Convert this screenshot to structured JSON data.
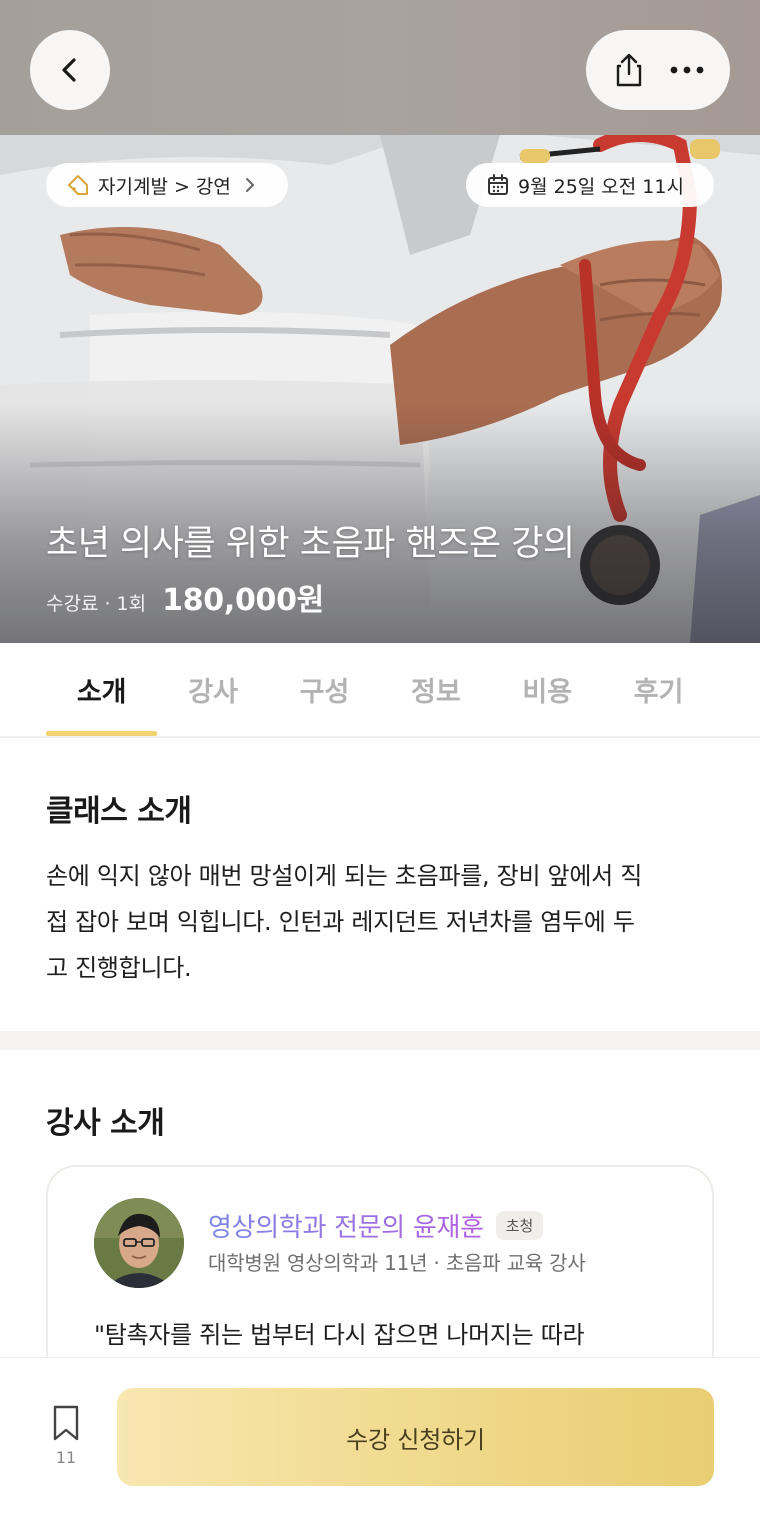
{
  "colors": {
    "accent": "#f2d372",
    "tab_inactive": "#b3b3b3",
    "apply_button": "#f0d98c",
    "instructor_name": "#8d69e6"
  },
  "topbar": {
    "back_icon": "chevron-left-icon",
    "share_icon": "share-icon",
    "more_icon": "more-horizontal-icon"
  },
  "hero": {
    "category_chip": {
      "icon": "tag-icon",
      "label": "자기계발 > 강연"
    },
    "date_chip": {
      "icon": "calendar-icon",
      "label": "9월 25일 오전 11시"
    },
    "title": "초년 의사를 위한 초음파 핸즈온 강의",
    "fee_label": "수강료 · 1회",
    "fee_value": "180,000원"
  },
  "tabs": [
    {
      "label": "소개",
      "active": true
    },
    {
      "label": "강사",
      "active": false
    },
    {
      "label": "구성",
      "active": false
    },
    {
      "label": "정보",
      "active": false
    },
    {
      "label": "비용",
      "active": false
    },
    {
      "label": "후기",
      "active": false
    }
  ],
  "class_intro": {
    "title": "클래스 소개",
    "lines": [
      "손에 익지 않아 매번 망설이게 되는 초음파를, 장비 앞에서 직",
      "접 잡아 보며 익힙니다. 인턴과 레지던트 저년차를 염두에 두",
      "고 진행합니다."
    ]
  },
  "instructor": {
    "section_title": "강사 소개",
    "name": "영상의학과 전문의 윤재훈",
    "badge": "초청",
    "subtitle": "대학병원 영상의학과 11년 · 초음파 교육 강사",
    "quote": "\"탐촉자를 쥐는 법부터 다시 잡으면 나머지는 따라"
  },
  "bottom": {
    "bookmark_icon": "bookmark-icon",
    "bookmark_count": "11",
    "apply_label": "수강 신청하기"
  }
}
